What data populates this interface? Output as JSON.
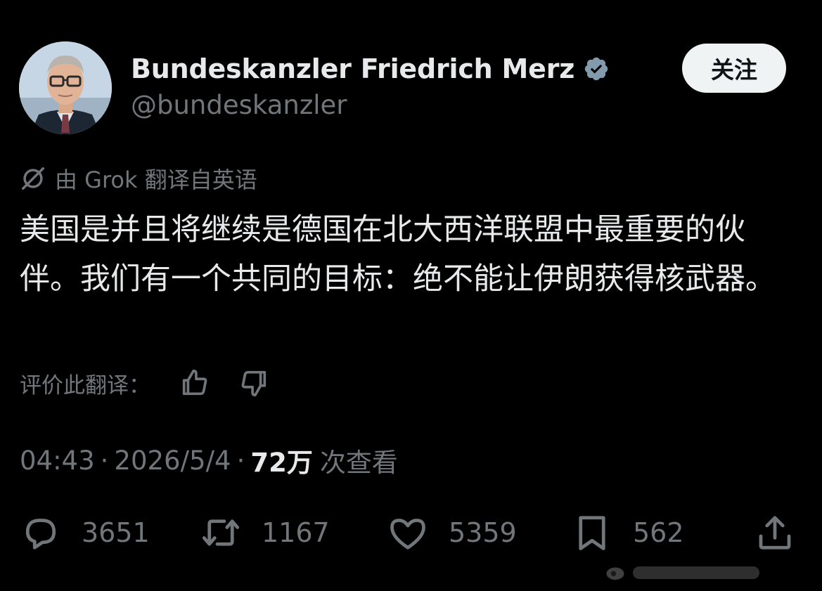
{
  "author": {
    "display_name": "Bundeskanzler Friedrich Merz",
    "handle": "@bundeskanzler",
    "verified": true
  },
  "follow_button": {
    "label": "关注"
  },
  "translation": {
    "label": "由 Grok 翻译自英语"
  },
  "tweet": {
    "text": "美国是并且将继续是德国在北大西洋联盟中最重要的伙伴。我们有一个共同的目标：绝不能让伊朗获得核武器。"
  },
  "rate_translation": {
    "label": "评价此翻译："
  },
  "meta": {
    "time": "04:43",
    "separator": "·",
    "date": "2026/5/4",
    "views_count": "72万",
    "views_label": "次查看"
  },
  "actions": {
    "replies": "3651",
    "reposts": "1167",
    "likes": "5359",
    "bookmarks": "562"
  },
  "colors": {
    "background": "#000000",
    "text_primary": "#e7e9ea",
    "text_secondary": "#71767b",
    "verified_badge": "#829aab",
    "follow_button_bg": "#eff3f4"
  }
}
